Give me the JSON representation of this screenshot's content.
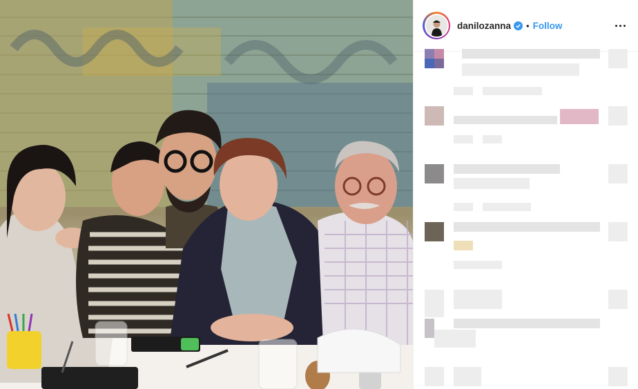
{
  "post": {
    "username": "danilozanna",
    "separator": "•",
    "follow_label": "Follow"
  },
  "icons": {
    "verified": "verified-badge-icon",
    "more": "more-options-icon"
  },
  "colors": {
    "link": "#3897f0",
    "text": "#262626",
    "border": "#efefef",
    "blur": "#e4e4e4"
  }
}
